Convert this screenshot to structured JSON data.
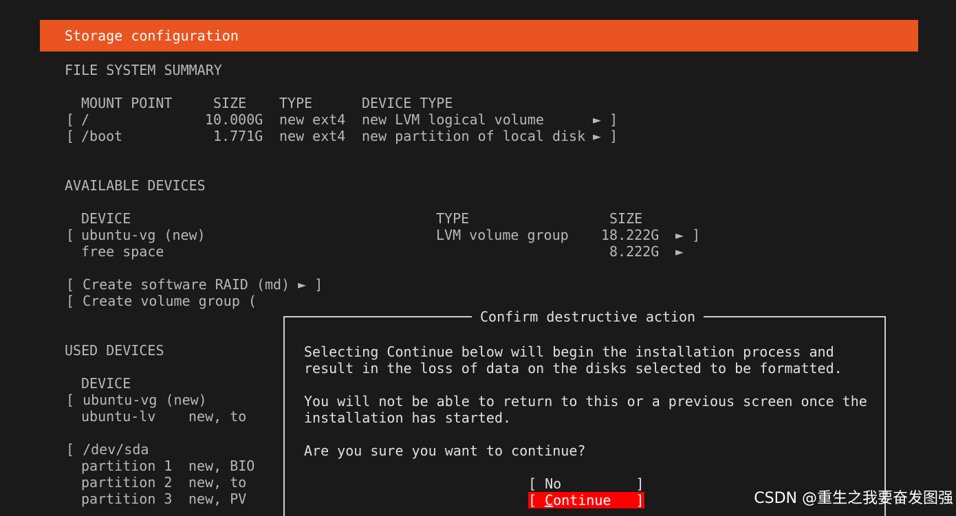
{
  "header": {
    "title": "Storage configuration"
  },
  "fs_summary": {
    "heading": "FILE SYSTEM SUMMARY",
    "col_mount": "MOUNT POINT",
    "col_size": "SIZE",
    "col_type": "TYPE",
    "col_device_type": "DEVICE TYPE",
    "rows": [
      {
        "bracket": "[",
        "mount": "/",
        "size": "10.000G",
        "type": "new ext4",
        "device_type": "new LVM logical volume",
        "arrow": "► ]"
      },
      {
        "bracket": "[",
        "mount": "/boot",
        "size": "1.771G",
        "type": "new ext4",
        "device_type": "new partition of local disk",
        "arrow": "► ]"
      }
    ]
  },
  "available": {
    "heading": "AVAILABLE DEVICES",
    "col_device": "DEVICE",
    "col_type": "TYPE",
    "col_size": "SIZE",
    "vg_bracket": "[",
    "vg_name": "ubuntu-vg (new)",
    "vg_type": "LVM volume group",
    "vg_size": "18.222G",
    "vg_arrow": "► ]",
    "free_label": "free space",
    "free_size": "8.222G",
    "free_arrow": "►",
    "raid_action": "[ Create software RAID (md) ► ]",
    "vg_action": "[ Create volume group ("
  },
  "used": {
    "heading": "USED DEVICES",
    "col_device": "DEVICE",
    "vg_row": "[ ubuntu-vg (new)",
    "lv_name": "ubuntu-lv",
    "lv_info": "new, to",
    "disk_row": "[ /dev/sda",
    "partitions": [
      {
        "name": "partition 1",
        "info": "new, BIO"
      },
      {
        "name": "partition 2",
        "info": "new, to"
      },
      {
        "name": "partition 3",
        "info": "new, PV"
      }
    ]
  },
  "dialog": {
    "title": "Confirm destructive action",
    "line1": "Selecting Continue below will begin the installation process and",
    "line2": "result in the loss of data on the disks selected to be formatted.",
    "line3": "You will not be able to return to this or a previous screen once the",
    "line4": "installation has started.",
    "question": "Are you sure you want to continue?",
    "no_label": "[ No         ]",
    "continue_open": "[ ",
    "continue_first": "C",
    "continue_rest": "ontinue   ]"
  },
  "watermark": "CSDN @重生之我要奋发图强",
  "colors": {
    "accent": "#e95420",
    "background": "#1a1a1a",
    "selected_button": "#ff0000"
  }
}
